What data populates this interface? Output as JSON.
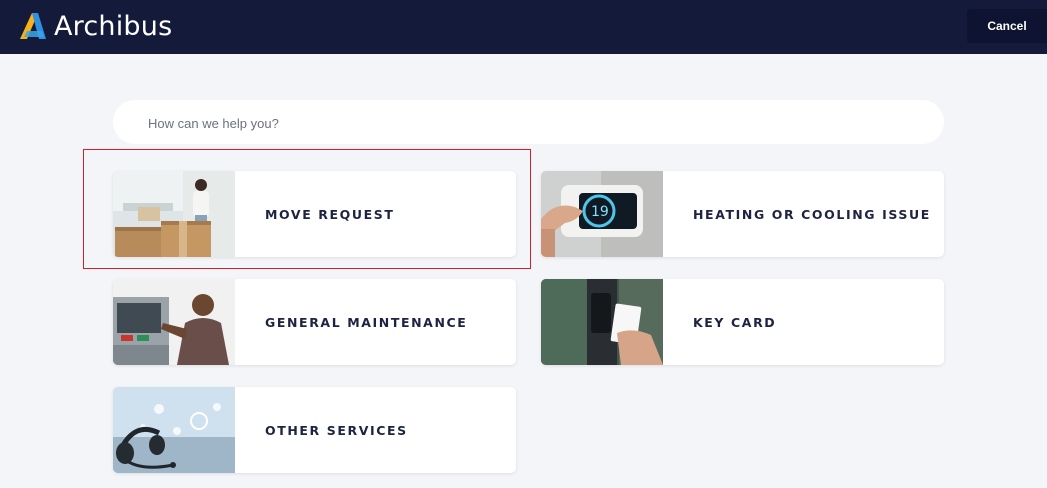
{
  "header": {
    "brand": "Archibus",
    "cancel_label": "Cancel"
  },
  "search": {
    "placeholder": "How can we help you?",
    "value": ""
  },
  "cards": [
    {
      "label": "MOVE REQUEST",
      "image": "person-packing-boxes"
    },
    {
      "label": "HEATING OR COOLING ISSUE",
      "image": "thermostat-19"
    },
    {
      "label": "GENERAL MAINTENANCE",
      "image": "technician-repairing-machine"
    },
    {
      "label": "KEY CARD",
      "image": "hand-holding-key-card"
    },
    {
      "label": "OTHER SERVICES",
      "image": "headset-service-icons"
    }
  ],
  "thermostat_reading": "19",
  "colors": {
    "header_bg": "#141b3a",
    "page_bg": "#f4f5f8",
    "highlight": "#d0202a",
    "logo_yellow": "#f5b21a",
    "logo_blue": "#2f8fe0"
  }
}
